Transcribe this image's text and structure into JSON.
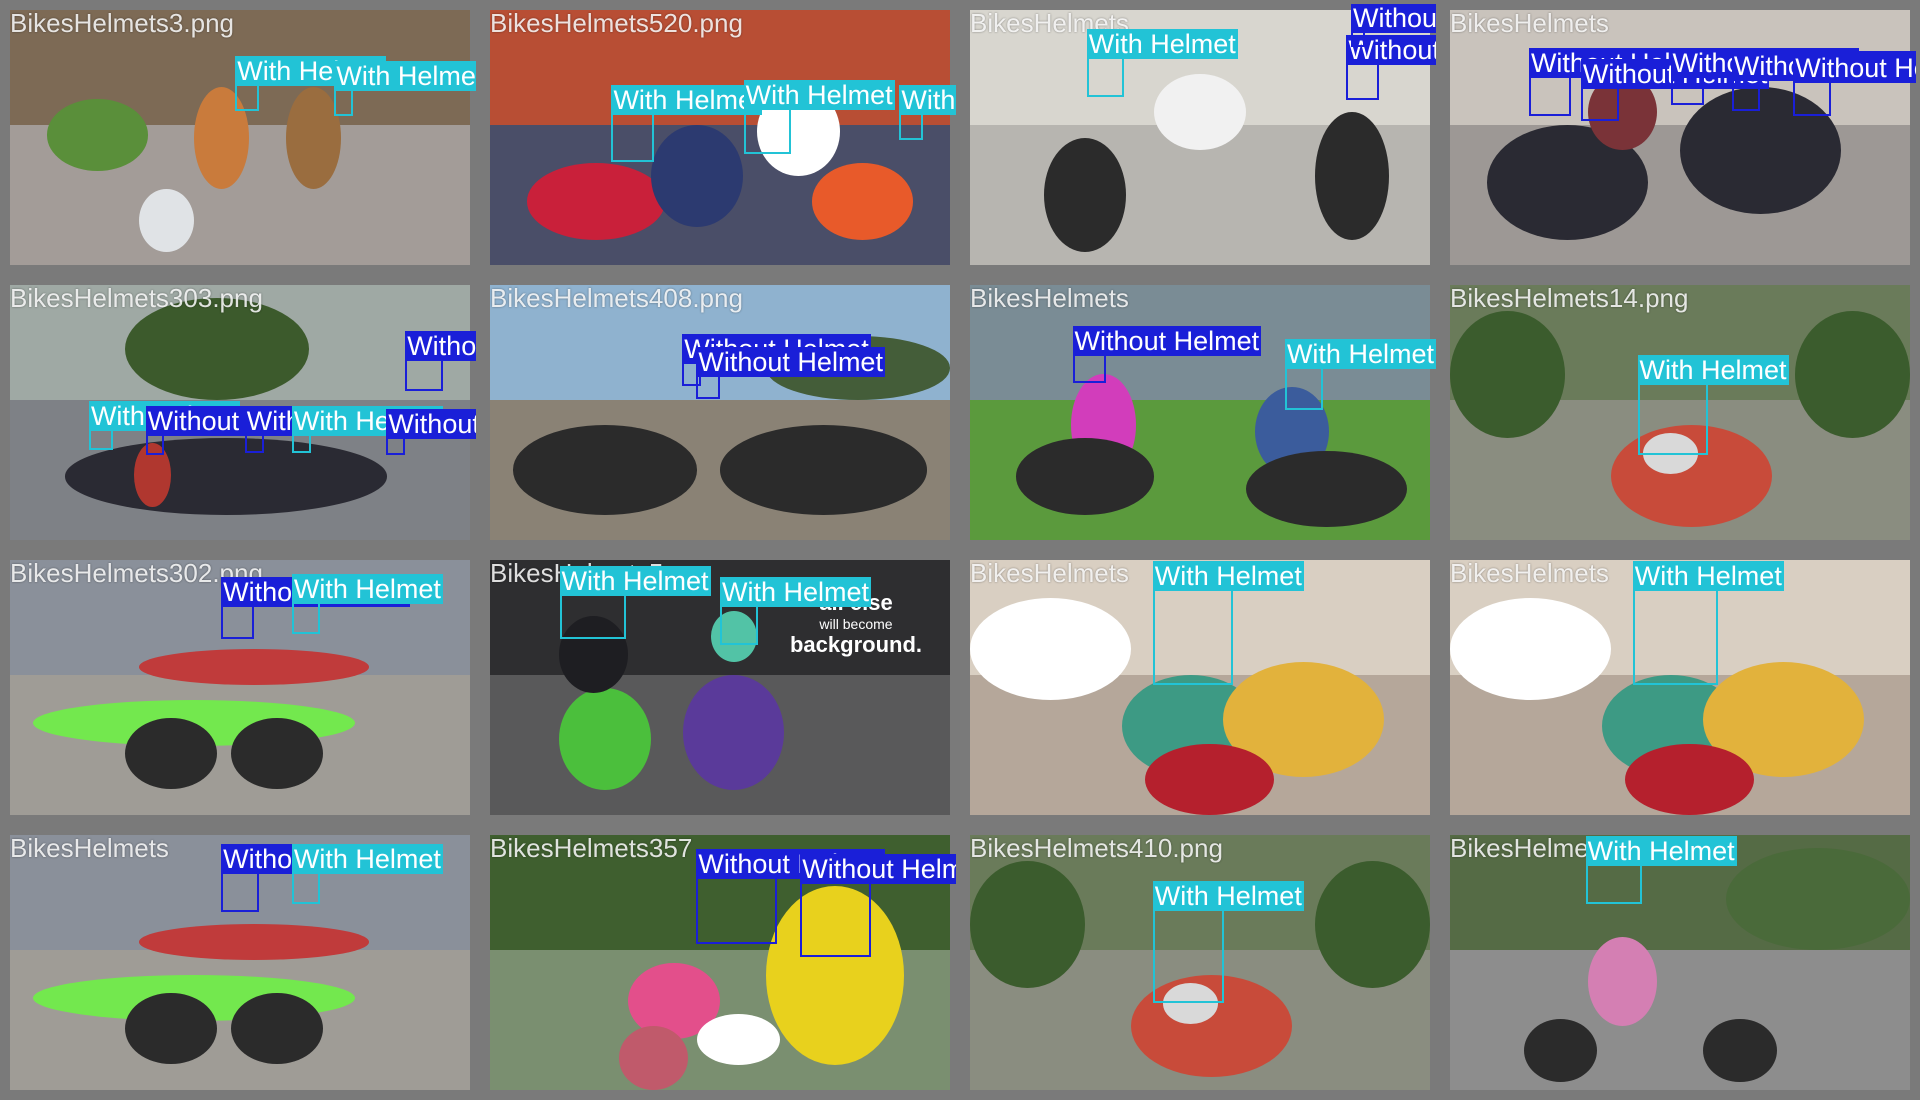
{
  "labels": {
    "with": "With Helmet",
    "without": "Without Helmet"
  },
  "colors": {
    "with": "#22c3d6",
    "without": "#1a1fd8",
    "border": "#7a7a7a"
  },
  "tiles": [
    {
      "filename": "BikesHelmets3.png",
      "scene": "street-cyclists",
      "detections": [
        {
          "cls": "with",
          "label": "With Helmet"
        },
        {
          "cls": "with",
          "label": "With Helmet"
        }
      ]
    },
    {
      "filename": "BikesHelmets520.png",
      "scene": "scooter-crowd",
      "detections": [
        {
          "cls": "with",
          "label": "With Helmet"
        },
        {
          "cls": "with",
          "label": "With Helmet"
        },
        {
          "cls": "with",
          "label": "With Helmet"
        }
      ]
    },
    {
      "filename": "BikesHelmets",
      "scene": "motorbike-road",
      "detections": [
        {
          "cls": "with",
          "label": "With Helmet"
        },
        {
          "cls": "without",
          "label": "Without Helmet"
        },
        {
          "cls": "without",
          "label": "Without Helmet"
        }
      ]
    },
    {
      "filename": "BikesHelmets",
      "scene": "riders-group",
      "detections": [
        {
          "cls": "without",
          "label": "Without Helmet"
        },
        {
          "cls": "without",
          "label": "Without Helmet"
        },
        {
          "cls": "without",
          "label": "Without Helmet"
        },
        {
          "cls": "without",
          "label": "Without Helmet"
        },
        {
          "cls": "without",
          "label": "Without Helmet"
        }
      ]
    },
    {
      "filename": "BikesHelmets303.png",
      "scene": "traffic-crowd",
      "detections": [
        {
          "cls": "with",
          "label": "With Helmet"
        },
        {
          "cls": "without",
          "label": "Without Helmet"
        },
        {
          "cls": "without",
          "label": "Without Helmet"
        },
        {
          "cls": "with",
          "label": "With Helmet"
        },
        {
          "cls": "without",
          "label": "Without Helmet"
        },
        {
          "cls": "without",
          "label": "Without Helmet"
        }
      ]
    },
    {
      "filename": "BikesHelmets408.png",
      "scene": "parked-bikes",
      "detections": [
        {
          "cls": "without",
          "label": "Without Helmet"
        },
        {
          "cls": "without",
          "label": "Without Helmet"
        }
      ]
    },
    {
      "filename": "BikesHelmets",
      "scene": "scooter-pink",
      "detections": [
        {
          "cls": "without",
          "label": "Without Helmet"
        },
        {
          "cls": "with",
          "label": "With Helmet"
        }
      ]
    },
    {
      "filename": "BikesHelmets14.png",
      "scene": "smiling-rider",
      "detections": [
        {
          "cls": "with",
          "label": "With Helmet"
        }
      ]
    },
    {
      "filename": "BikesHelmets302.png",
      "scene": "cyclists-lane",
      "detections": [
        {
          "cls": "without",
          "label": "Without Helmet"
        },
        {
          "cls": "with",
          "label": "With Helmet"
        }
      ]
    },
    {
      "filename": "BikesHelmets5",
      "scene": "scooter-ad",
      "ad_text": {
        "line1": "all else",
        "line2": "will become",
        "line3": "background."
      },
      "detections": [
        {
          "cls": "with",
          "label": "With Helmet"
        },
        {
          "cls": "with",
          "label": "With Helmet"
        }
      ]
    },
    {
      "filename": "BikesHelmets",
      "scene": "women-scooter",
      "detections": [
        {
          "cls": "with",
          "label": "With Helmet"
        }
      ]
    },
    {
      "filename": "BikesHelmets",
      "scene": "women-scooter",
      "detections": [
        {
          "cls": "with",
          "label": "With Helmet"
        }
      ]
    },
    {
      "filename": "BikesHelmets",
      "scene": "cyclists-lane",
      "detections": [
        {
          "cls": "without",
          "label": "Without Helmet"
        },
        {
          "cls": "with",
          "label": "With Helmet"
        }
      ]
    },
    {
      "filename": "BikesHelmets357",
      "scene": "two-riders",
      "detections": [
        {
          "cls": "without",
          "label": "Without Helmet"
        },
        {
          "cls": "without",
          "label": "Without Helmet"
        }
      ]
    },
    {
      "filename": "BikesHelmets410.png",
      "scene": "smiling-rider",
      "detections": [
        {
          "cls": "with",
          "label": "With Helmet"
        }
      ]
    },
    {
      "filename": "BikesHelmets142.png",
      "scene": "girl-bicycle",
      "detections": [
        {
          "cls": "with",
          "label": "With Helmet"
        }
      ]
    }
  ]
}
